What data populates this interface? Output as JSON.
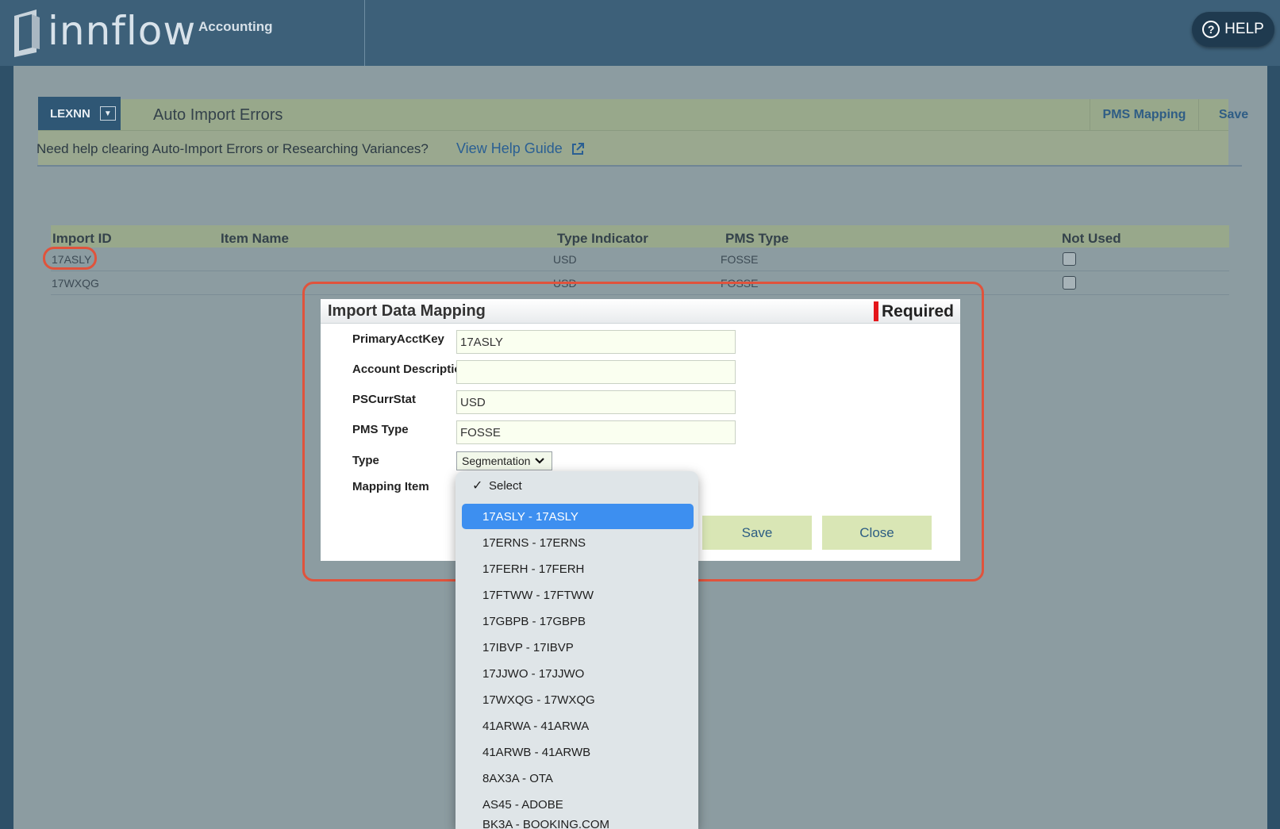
{
  "header": {
    "logo_text": "innflow",
    "logo_sub": "Accounting",
    "help_label": "HELP"
  },
  "toolbar": {
    "property_code": "LEXNN",
    "title": "Auto Import Errors",
    "pms_mapping": "PMS Mapping",
    "save": "Save"
  },
  "helpline": {
    "text": "Need help clearing Auto-Import Errors or Researching Variances?",
    "link": "View Help Guide"
  },
  "table": {
    "columns": [
      "Import ID",
      "Item Name",
      "Type Indicator",
      "PMS Type",
      "Not Used"
    ],
    "rows": [
      {
        "import_id": "17ASLY",
        "item_name": "",
        "type_indicator": "USD",
        "pms_type": "FOSSE"
      },
      {
        "import_id": "17WXQG",
        "item_name": "",
        "type_indicator": "USD",
        "pms_type": "FOSSE"
      }
    ]
  },
  "modal": {
    "title": "Import Data Mapping",
    "required": "Required",
    "fields": [
      {
        "label": "PrimaryAcctKey",
        "value": "17ASLY"
      },
      {
        "label": "Account Description",
        "value": ""
      },
      {
        "label": "PSCurrStat",
        "value": "USD"
      },
      {
        "label": "PMS Type",
        "value": "FOSSE"
      }
    ],
    "type_label": "Type",
    "type_value": "Segmentation",
    "mapping_label": "Mapping Item",
    "save": "Save",
    "close": "Close"
  },
  "dropdown": {
    "selected_index": 1,
    "options": [
      "Select",
      "17ASLY - 17ASLY",
      "17ERNS - 17ERNS",
      "17FERH - 17FERH",
      "17FTWW - 17FTWW",
      "17GBPB - 17GBPB",
      "17IBVP - 17IBVP",
      "17JJWO - 17JJWO",
      "17WXQG - 17WXQG",
      "41ARWA - 41ARWA",
      "41ARWB - 41ARWB",
      "8AX3A - OTA",
      "AS45 - ADOBE",
      "BK3A - BOOKING.COM"
    ]
  },
  "colors": {
    "header_bg": "#3d6079",
    "accent_blue": "#3d8ff0",
    "callout_red": "#e0533c",
    "button_green": "#d9e6b5"
  }
}
